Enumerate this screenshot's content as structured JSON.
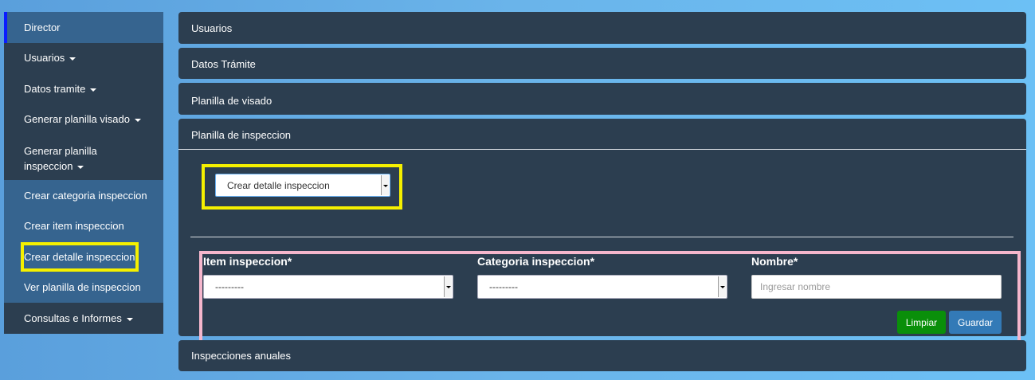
{
  "sidebar": {
    "items": [
      {
        "label": "Director"
      },
      {
        "label": "Usuarios"
      },
      {
        "label": "Datos tramite"
      },
      {
        "label": "Generar planilla visado"
      },
      {
        "label_line1": "Generar planilla",
        "label_line2": "inspeccion"
      },
      {
        "label": "Crear categoria inspeccion"
      },
      {
        "label": "Crear item inspeccion"
      },
      {
        "label": "Crear detalle inspeccion"
      },
      {
        "label": "Ver planilla de inspeccion"
      },
      {
        "label": "Consultas e Informes"
      }
    ]
  },
  "panels": {
    "usuarios": "Usuarios",
    "datos_tramite": "Datos Trámite",
    "planilla_visado": "Planilla de visado",
    "planilla_inspeccion": "Planilla de inspeccion",
    "inspecciones_anuales": "Inspecciones anuales"
  },
  "inspeccion_form": {
    "action_select": {
      "selected": "Crear detalle inspeccion"
    },
    "item": {
      "label": "Item inspeccion*",
      "selected": "---------"
    },
    "categoria": {
      "label": "Categoria inspeccion*",
      "selected": "---------"
    },
    "nombre": {
      "label": "Nombre*",
      "value": "",
      "placeholder": "Ingresar nombre"
    },
    "buttons": {
      "limpiar": "Limpiar",
      "guardar": "Guardar"
    }
  },
  "colors": {
    "panel_bg": "#2c3e50",
    "sidebar_sub_bg": "#36648f",
    "highlight_yellow": "#f5f000",
    "highlight_pink": "#f5b6cc",
    "btn_limpiar": "#0a8f0a",
    "btn_guardar": "#337ab7"
  }
}
